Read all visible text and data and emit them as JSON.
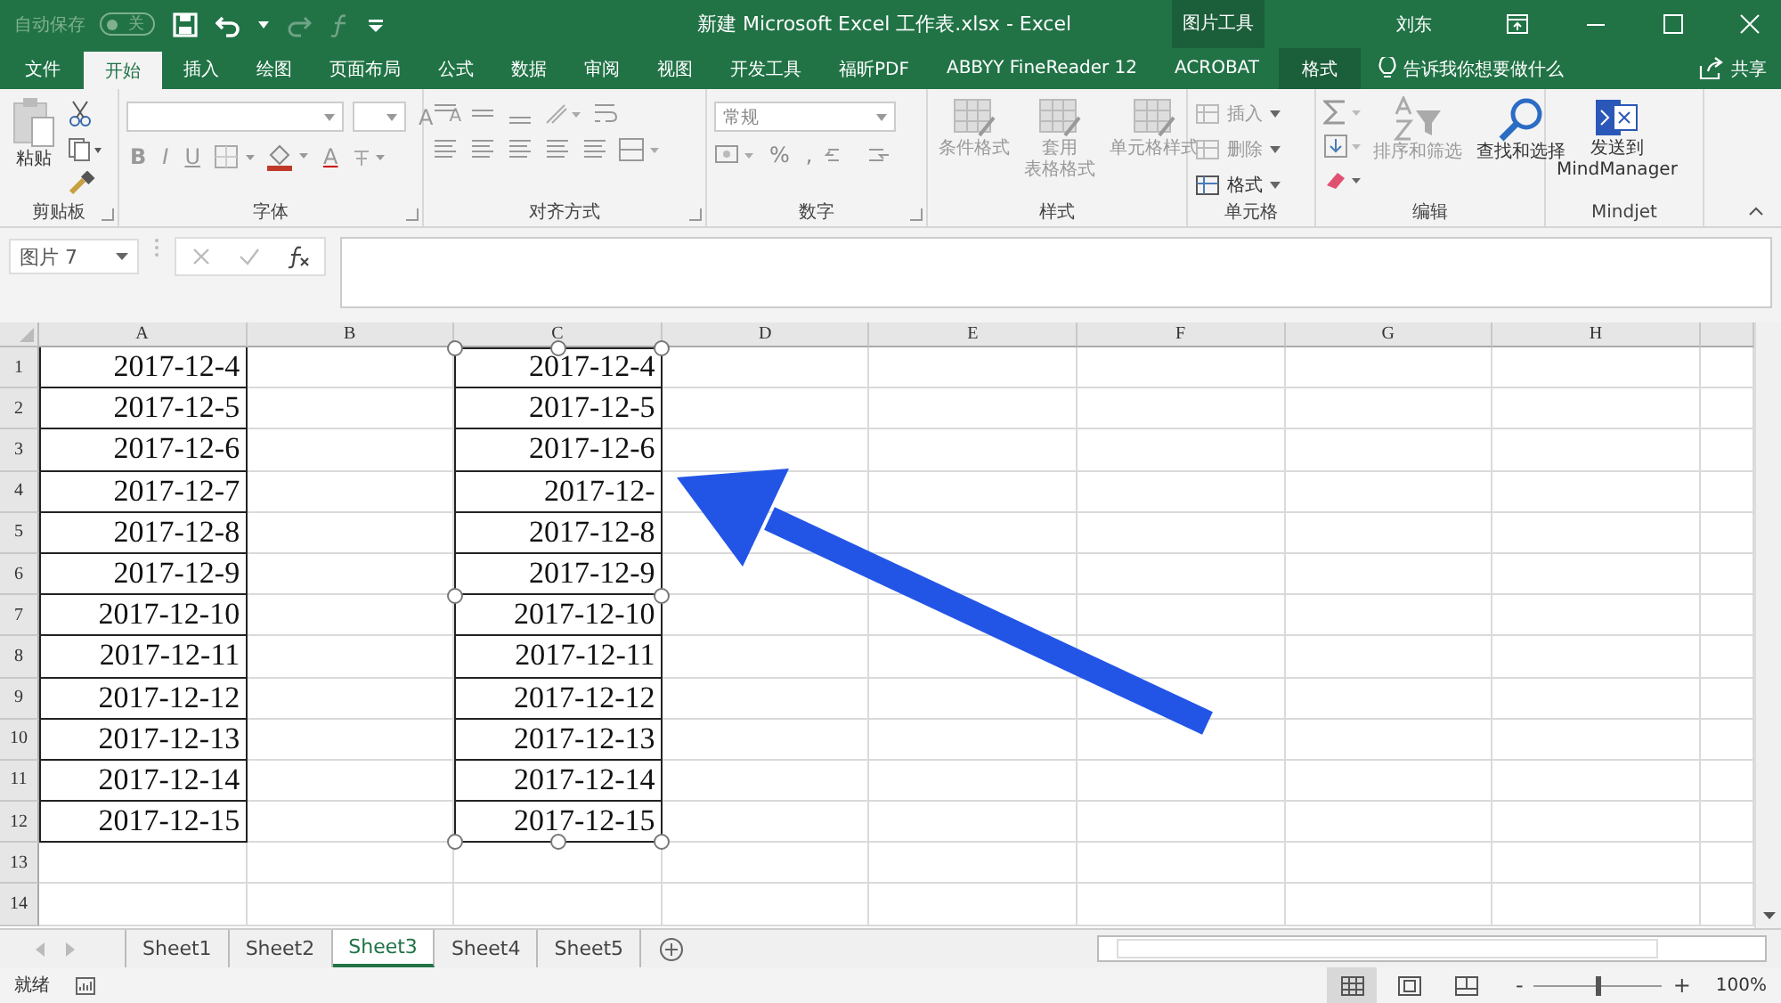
{
  "title_bar": {
    "autosave_label": "自动保存",
    "autosave_state": "关",
    "autosave_on": false,
    "title": "新建 Microsoft Excel 工作表.xlsx  -  Excel",
    "context_group": "图片工具",
    "user": "刘东"
  },
  "tabs": [
    {
      "label": "文件",
      "selected": false,
      "kind": "normal"
    },
    {
      "label": "开始",
      "selected": true,
      "kind": "normal"
    },
    {
      "label": "插入",
      "selected": false,
      "kind": "normal"
    },
    {
      "label": "绘图",
      "selected": false,
      "kind": "normal"
    },
    {
      "label": "页面布局",
      "selected": false,
      "kind": "normal"
    },
    {
      "label": "公式",
      "selected": false,
      "kind": "normal"
    },
    {
      "label": "数据",
      "selected": false,
      "kind": "normal"
    },
    {
      "label": "审阅",
      "selected": false,
      "kind": "normal"
    },
    {
      "label": "视图",
      "selected": false,
      "kind": "normal"
    },
    {
      "label": "开发工具",
      "selected": false,
      "kind": "normal"
    },
    {
      "label": "福昕PDF",
      "selected": false,
      "kind": "normal"
    },
    {
      "label": "ABBYY FineReader 12",
      "selected": false,
      "kind": "normal"
    },
    {
      "label": "ACROBAT",
      "selected": false,
      "kind": "normal"
    },
    {
      "label": "格式",
      "selected": false,
      "kind": "context"
    }
  ],
  "tell_me": "告诉我你想要做什么",
  "share": "共享",
  "ribbon": {
    "clipboard": {
      "paste": "粘贴",
      "label": "剪贴板"
    },
    "font": {
      "disabled": true,
      "grow": "A",
      "shrink": "A",
      "bold": "B",
      "italic": "I",
      "underline": "U",
      "font_color_label": "A",
      "label": "字体"
    },
    "alignment": {
      "label": "对齐方式"
    },
    "number": {
      "format": "常规",
      "percent": "%",
      "comma": ",",
      "label": "数字"
    },
    "styles": {
      "buttons": [
        {
          "lines": [
            "条件格式"
          ],
          "disabled": true
        },
        {
          "lines": [
            "套用",
            "表格格式"
          ],
          "disabled": true
        },
        {
          "lines": [
            "单元格样式"
          ],
          "disabled": true
        }
      ],
      "label": "样式"
    },
    "cells": {
      "buttons": [
        {
          "label": "插入",
          "disabled": true
        },
        {
          "label": "删除",
          "disabled": true
        },
        {
          "label": "格式",
          "disabled": false
        }
      ],
      "label": "单元格"
    },
    "editing": {
      "buttons": [
        {
          "lines": [
            "排序和筛选"
          ],
          "disabled": true
        },
        {
          "lines": [
            "查找和选择"
          ],
          "disabled": false
        }
      ],
      "label": "编辑"
    },
    "addin": {
      "lines": [
        "发送到",
        "MindManager"
      ],
      "label": "Mindjet"
    }
  },
  "formula_bar": {
    "name_box": "图片 7"
  },
  "grid": {
    "columns": [
      "A",
      "B",
      "C",
      "D",
      "E",
      "F",
      "G",
      "H"
    ],
    "rows": [
      {
        "number": "1",
        "a": "2017-12-4",
        "c": "2017-12-4"
      },
      {
        "number": "2",
        "a": "2017-12-5",
        "c": "2017-12-5"
      },
      {
        "number": "3",
        "a": "2017-12-6",
        "c": "2017-12-6"
      },
      {
        "number": "4",
        "a": "2017-12-7",
        "c": "2017-12-"
      },
      {
        "number": "5",
        "a": "2017-12-8",
        "c": "2017-12-8"
      },
      {
        "number": "6",
        "a": "2017-12-9",
        "c": "2017-12-9"
      },
      {
        "number": "7",
        "a": "2017-12-10",
        "c": "2017-12-10"
      },
      {
        "number": "8",
        "a": "2017-12-11",
        "c": "2017-12-11"
      },
      {
        "number": "9",
        "a": "2017-12-12",
        "c": "2017-12-12"
      },
      {
        "number": "10",
        "a": "2017-12-13",
        "c": "2017-12-13"
      },
      {
        "number": "11",
        "a": "2017-12-14",
        "c": "2017-12-14"
      },
      {
        "number": "12",
        "a": "2017-12-15",
        "c": "2017-12-15"
      },
      {
        "number": "13"
      },
      {
        "number": "14"
      }
    ]
  },
  "sheets": [
    {
      "label": "Sheet1",
      "selected": false
    },
    {
      "label": "Sheet2",
      "selected": false
    },
    {
      "label": "Sheet3",
      "selected": true
    },
    {
      "label": "Sheet4",
      "selected": false
    },
    {
      "label": "Sheet5",
      "selected": false
    }
  ],
  "status_bar": {
    "status": "就绪",
    "views": [
      {
        "kind": "normal",
        "selected": true
      },
      {
        "kind": "layout",
        "selected": false
      },
      {
        "kind": "break",
        "selected": false
      }
    ],
    "zoom_out": "-",
    "zoom_in": "+",
    "zoom": {
      "level": 0.5
    },
    "zoom_text": "100%"
  }
}
